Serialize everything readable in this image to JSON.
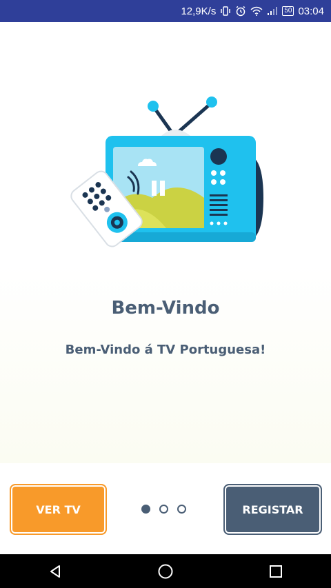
{
  "status_bar": {
    "net_speed": "12,9K/s",
    "battery_level": "50",
    "time": "03:04",
    "icons": [
      "vibrate-icon",
      "alarm-icon",
      "wifi-icon",
      "signal-icon",
      "battery-icon"
    ]
  },
  "welcome": {
    "title": "Bem-Vindo",
    "subtitle": "Bem-Vindo á TV Portuguesa!",
    "illustration_icon": "tv-with-remote-illustration"
  },
  "pager": {
    "total": 3,
    "active_index": 0
  },
  "buttons": {
    "watch_tv": "VER TV",
    "register": "REGISTAR"
  },
  "colors": {
    "status_bar": "#2f3f99",
    "primary": "#f89a2a",
    "secondary": "#4a5e75",
    "text": "#4a5e75",
    "tv_body": "#1fc1ee"
  },
  "nav_bar": {
    "icons": [
      "back-icon",
      "home-icon",
      "recents-icon"
    ]
  }
}
